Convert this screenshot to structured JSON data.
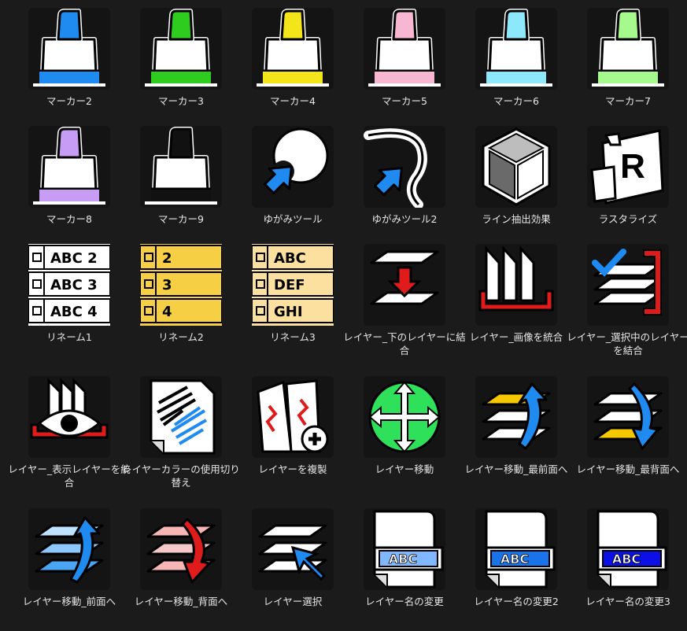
{
  "window": {
    "background": "#1b1b1b"
  },
  "icons": [
    {
      "label": "マーカー2",
      "icon": "marker-icon",
      "color": "#1f8bf0"
    },
    {
      "label": "マーカー3",
      "icon": "marker-icon",
      "color": "#2ecc1f"
    },
    {
      "label": "マーカー4",
      "icon": "marker-icon",
      "color": "#f4e41a"
    },
    {
      "label": "マーカー5",
      "icon": "marker-icon",
      "color": "#f7b6d2"
    },
    {
      "label": "マーカー6",
      "icon": "marker-icon",
      "color": "#8ee8fb"
    },
    {
      "label": "マーカー7",
      "icon": "marker-icon",
      "color": "#a6f98d"
    },
    {
      "label": "マーカー8",
      "icon": "marker-icon",
      "color": "#c79cf4"
    },
    {
      "label": "マーカー9",
      "icon": "marker-icon",
      "color": "#111111"
    },
    {
      "label": "ゆがみツール",
      "icon": "distort-tool-icon"
    },
    {
      "label": "ゆがみツール2",
      "icon": "distort-tool-2-icon"
    },
    {
      "label": "ライン抽出効果",
      "icon": "line-extract-cube-icon"
    },
    {
      "label": "ラスタライズ",
      "icon": "rasterize-icon",
      "glyph": "R"
    },
    {
      "label": "リネーム1",
      "icon": "rename-list-icon",
      "rows": [
        "ABC 2",
        "ABC 3",
        "ABC 4"
      ],
      "color": "#ffffff"
    },
    {
      "label": "リネーム2",
      "icon": "rename-list-icon",
      "rows": [
        "2",
        "3",
        "4"
      ],
      "color": "#f7cf45"
    },
    {
      "label": "リネーム3",
      "icon": "rename-list-icon",
      "rows": [
        "ABC",
        "DEF",
        "GHI"
      ],
      "color": "#fbe0a0"
    },
    {
      "label": "レイヤー_下のレイヤーに結合",
      "icon": "merge-down-icon"
    },
    {
      "label": "レイヤー_画像を統合",
      "icon": "flatten-image-icon"
    },
    {
      "label": "レイヤー_選択中のレイヤーを結合",
      "icon": "merge-selected-icon"
    },
    {
      "label": "レイヤー_表示レイヤーを統合",
      "icon": "merge-visible-icon"
    },
    {
      "label": "レイヤーカラーの使用切り替え",
      "icon": "layer-color-toggle-icon"
    },
    {
      "label": "レイヤーを複製",
      "icon": "duplicate-layer-icon"
    },
    {
      "label": "レイヤー移動",
      "icon": "move-layer-icon"
    },
    {
      "label": "レイヤー移動_最前面へ",
      "icon": "bring-to-front-icon"
    },
    {
      "label": "レイヤー移動_最背面へ",
      "icon": "send-to-back-icon"
    },
    {
      "label": "レイヤー移動_前面へ",
      "icon": "bring-forward-icon"
    },
    {
      "label": "レイヤー移動_背面へ",
      "icon": "send-backward-icon"
    },
    {
      "label": "レイヤー選択",
      "icon": "select-layer-icon"
    },
    {
      "label": "レイヤー名の変更",
      "icon": "rename-layer-icon",
      "tag": "ABC",
      "color": "#7fb8ff"
    },
    {
      "label": "レイヤー名の変更2",
      "icon": "rename-layer-icon",
      "tag": "ABC",
      "color": "#1a73e8"
    },
    {
      "label": "レイヤー名の変更3",
      "icon": "rename-layer-icon",
      "tag": "ABC",
      "color": "#0a10e6"
    }
  ]
}
